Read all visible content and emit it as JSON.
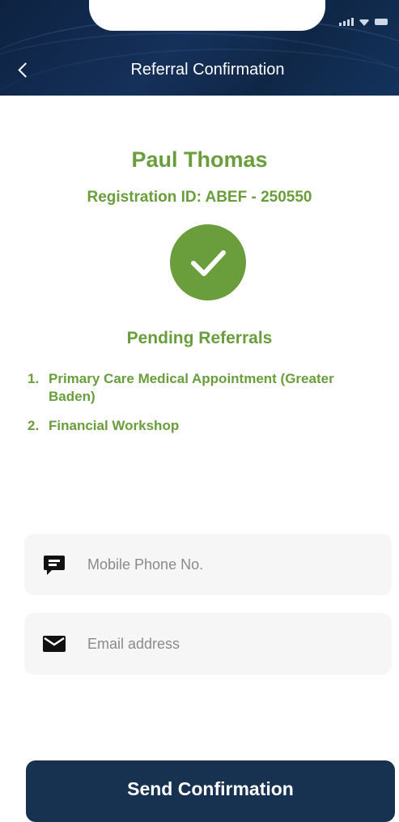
{
  "header": {
    "title": "Referral Confirmation",
    "back_icon": "chevron-left-icon"
  },
  "user": {
    "name": "Paul Thomas",
    "registration_id": "Registration ID: ABEF - 250550"
  },
  "status": {
    "icon": "checkmark-icon"
  },
  "referrals": {
    "title": "Pending Referrals",
    "items": [
      {
        "number": "1.",
        "text": "Primary Care Medical Appointment (Greater Baden)"
      },
      {
        "number": "2.",
        "text": "Financial Workshop"
      }
    ]
  },
  "form": {
    "phone": {
      "placeholder": "Mobile Phone No.",
      "icon": "message-icon"
    },
    "email": {
      "placeholder": "Email address",
      "icon": "envelope-icon"
    }
  },
  "actions": {
    "send_label": "Send Confirmation"
  },
  "colors": {
    "header_bg": "#0f2747",
    "accent_green": "#6a9e3c",
    "button_bg": "#173150",
    "input_bg": "#f6f6f6"
  }
}
